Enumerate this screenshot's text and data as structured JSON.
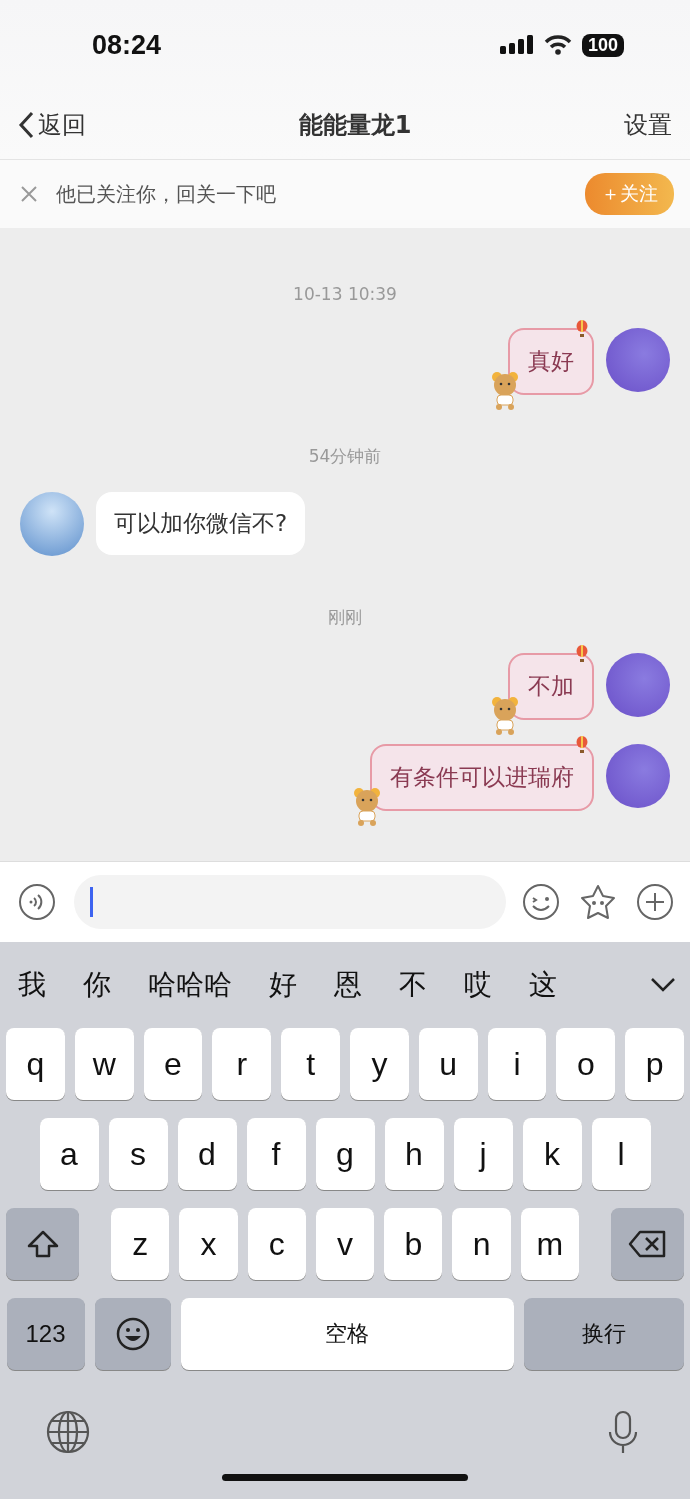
{
  "status_bar": {
    "time": "08:24",
    "battery": "100"
  },
  "nav": {
    "back": "返回",
    "title": "能能量龙1",
    "settings": "设置"
  },
  "follow_banner": {
    "text": "他已关注你，回关一下吧",
    "button": "＋关注"
  },
  "messages": [
    {
      "kind": "time",
      "text": "10-13 10:39"
    },
    {
      "kind": "outgoing",
      "text": "真好"
    },
    {
      "kind": "time",
      "text": "54分钟前"
    },
    {
      "kind": "incoming",
      "text": "可以加你微信不?"
    },
    {
      "kind": "time",
      "text": "刚刚"
    },
    {
      "kind": "outgoing",
      "text": "不加"
    },
    {
      "kind": "outgoing",
      "text": "有条件可以进瑞府"
    }
  ],
  "candidates": [
    "我",
    "你",
    "哈哈哈",
    "好",
    "恩",
    "不",
    "哎",
    "这"
  ],
  "keyboard": {
    "rows": [
      [
        "q",
        "w",
        "e",
        "r",
        "t",
        "y",
        "u",
        "i",
        "o",
        "p"
      ],
      [
        "a",
        "s",
        "d",
        "f",
        "g",
        "h",
        "j",
        "k",
        "l"
      ],
      [
        "z",
        "x",
        "c",
        "v",
        "b",
        "n",
        "m"
      ]
    ],
    "bottom": [
      {
        "kind": "numbers",
        "label": "123"
      },
      {
        "kind": "emoji"
      },
      {
        "kind": "space",
        "label": "空格"
      },
      {
        "kind": "return",
        "label": "换行"
      }
    ]
  }
}
